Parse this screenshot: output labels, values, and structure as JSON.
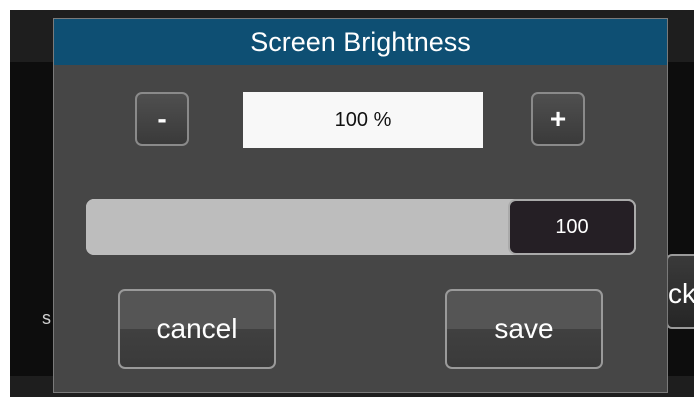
{
  "background": {
    "left_text": "s",
    "right_button_label": "ck"
  },
  "dialog": {
    "title": "Screen Brightness",
    "stepper": {
      "minus_label": "-",
      "plus_label": "+",
      "value_display": "100 %"
    },
    "slider": {
      "value": 100,
      "value_label": "100",
      "min": 0,
      "max": 100
    },
    "buttons": {
      "cancel_label": "cancel",
      "save_label": "save"
    }
  },
  "colors": {
    "title_bar": "#0e4f73",
    "dialog_bg": "#464646",
    "slider_track": "#bdbdbd",
    "slider_thumb": "#251f25"
  }
}
